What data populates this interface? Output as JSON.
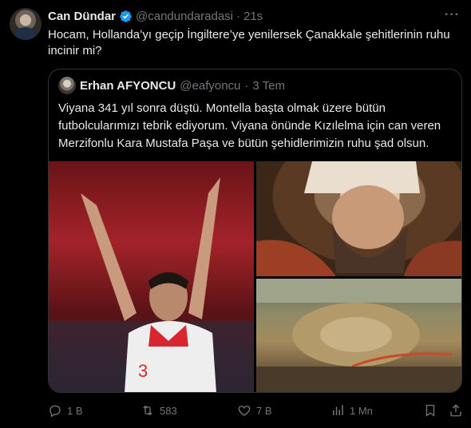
{
  "tweet": {
    "name": "Can Dündar",
    "handle": "@candundaradasi",
    "separator": "·",
    "time": "21s",
    "more": "···",
    "text": "Hocam, Hollanda’yı geçip İngiltere’ye yenilersek Çanakkale şehitlerinin ruhu incinir mi?"
  },
  "quote": {
    "name": "Erhan AFYONCU",
    "handle": "@eafyoncu",
    "separator": "·",
    "time": "3 Tem",
    "text": "Viyana 341 yıl sonra düştü. Montella başta olmak üzere bütün futbolcularımızı tebrik ediyorum. Viyana önünde Kızılelma için can veren Merzifonlu Kara Mustafa Paşa ve bütün şehidlerimizin ruhu şad olsun."
  },
  "actions": {
    "reply": "1 B",
    "retweet": "583",
    "like": "7 B",
    "views": "1 Mn"
  },
  "colors": {
    "background": "#000000",
    "text": "#e7e9ea",
    "secondary": "#71767b",
    "border": "#2f3336",
    "verified": "#1d9bf0"
  },
  "icons": [
    "verified-badge-icon",
    "more-icon",
    "reply-icon",
    "retweet-icon",
    "like-icon",
    "views-icon",
    "bookmark-icon",
    "share-icon"
  ]
}
